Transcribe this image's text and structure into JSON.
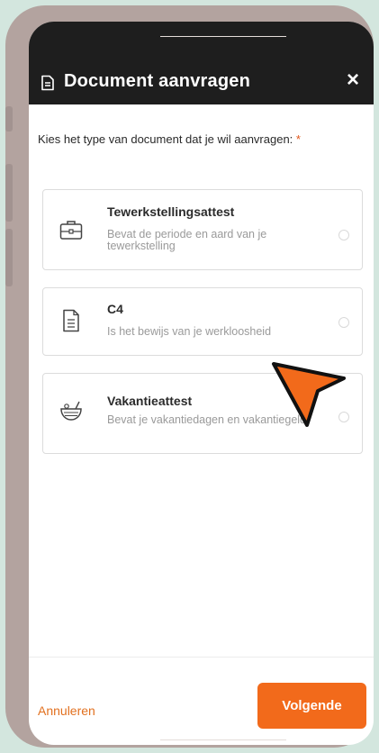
{
  "dialog": {
    "title": "Document aanvragen",
    "close_label": "×"
  },
  "prompt": {
    "text": "Kies het type van document dat je wil aanvragen: ",
    "required_marker": "*"
  },
  "options": [
    {
      "name": "Tewerkstellingsattest",
      "description": "Bevat de periode en aard van je tewerkstelling",
      "icon": "briefcase-icon",
      "selected": false
    },
    {
      "name": "C4",
      "description": "Is het bewijs van je werkloosheid",
      "icon": "document-icon",
      "selected": false
    },
    {
      "name": "Vakantieattest",
      "description": "Bevat je vakantiedagen en vakantiegeld",
      "icon": "cocktail-icon",
      "selected": false
    }
  ],
  "footer": {
    "cancel_label": "Annuleren",
    "next_label": "Volgende"
  },
  "colors": {
    "accent": "#f26a1b",
    "header_bg": "#1e1e1e",
    "background": "#d3e6de",
    "phone_frame": "#b3a39f",
    "cursor": "#f26a1b"
  }
}
